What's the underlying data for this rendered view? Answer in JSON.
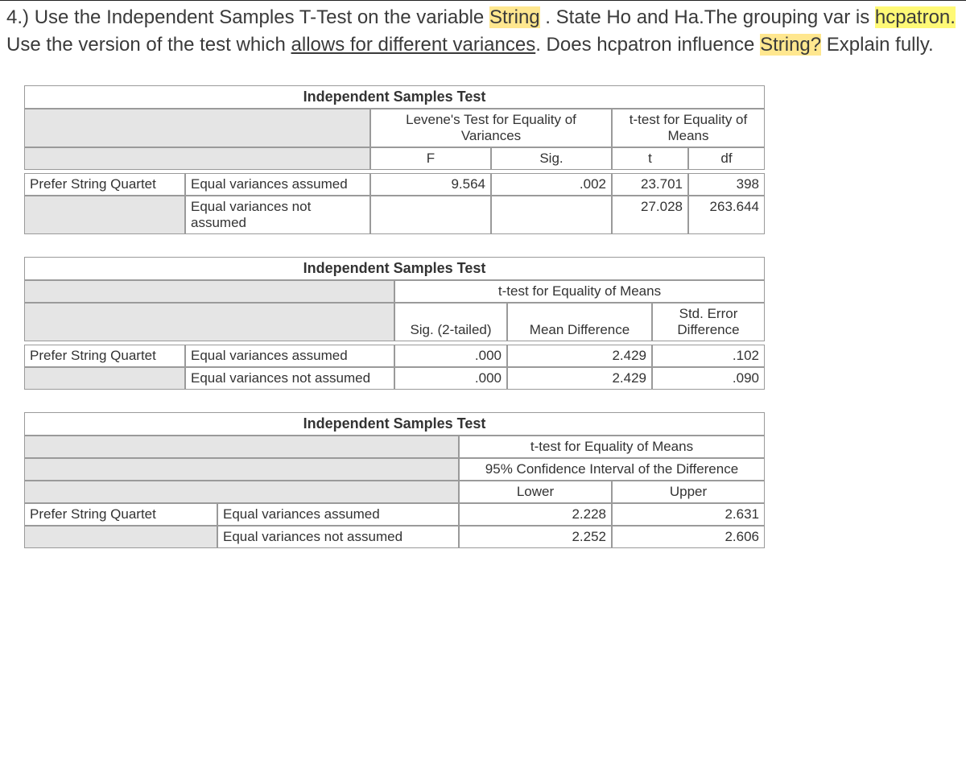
{
  "question": {
    "num": "4.) ",
    "p1": "Use the Independent Samples T-Test on the variable ",
    "hl1": "String",
    "p2": " . State Ho and Ha.The grouping var is ",
    "hl2": "hcpatron. ",
    "p3": "Use the version of the test which ",
    "ul": "allows for different variances",
    "p4": ". Does hcpatron  influence ",
    "hl3": "String?",
    "p5": " Explain fully."
  },
  "t1": {
    "title": "Independent Samples Test",
    "h_levene": "Levene's Test for Equality of Variances",
    "h_ttest": "t-test for Equality of Means",
    "h_F": "F",
    "h_Sig": "Sig.",
    "h_t": "t",
    "h_df": "df",
    "rowLabel": "Prefer String Quartet",
    "row1": {
      "cond": "Equal variances assumed",
      "F": "9.564",
      "Sig": ".002",
      "t": "23.701",
      "df": "398"
    },
    "row2": {
      "cond": "Equal variances not assumed",
      "t": "27.028",
      "df": "263.644"
    }
  },
  "t2": {
    "title": "Independent Samples Test",
    "h_ttest": "t-test for Equality of Means",
    "h_sig2": "Sig. (2-tailed)",
    "h_md": "Mean Difference",
    "h_se": "Std. Error Difference",
    "rowLabel": "Prefer String Quartet",
    "row1": {
      "cond": "Equal variances assumed",
      "sig": ".000",
      "md": "2.429",
      "se": ".102"
    },
    "row2": {
      "cond": "Equal variances not assumed",
      "sig": ".000",
      "md": "2.429",
      "se": ".090"
    }
  },
  "t3": {
    "title": "Independent Samples Test",
    "h_ttest": "t-test for Equality of Means",
    "h_ci": "95% Confidence Interval of the Difference",
    "h_lower": "Lower",
    "h_upper": "Upper",
    "rowLabel": "Prefer String Quartet",
    "row1": {
      "cond": "Equal variances assumed",
      "lower": "2.228",
      "upper": "2.631"
    },
    "row2": {
      "cond": "Equal variances not assumed",
      "lower": "2.252",
      "upper": "2.606"
    }
  }
}
